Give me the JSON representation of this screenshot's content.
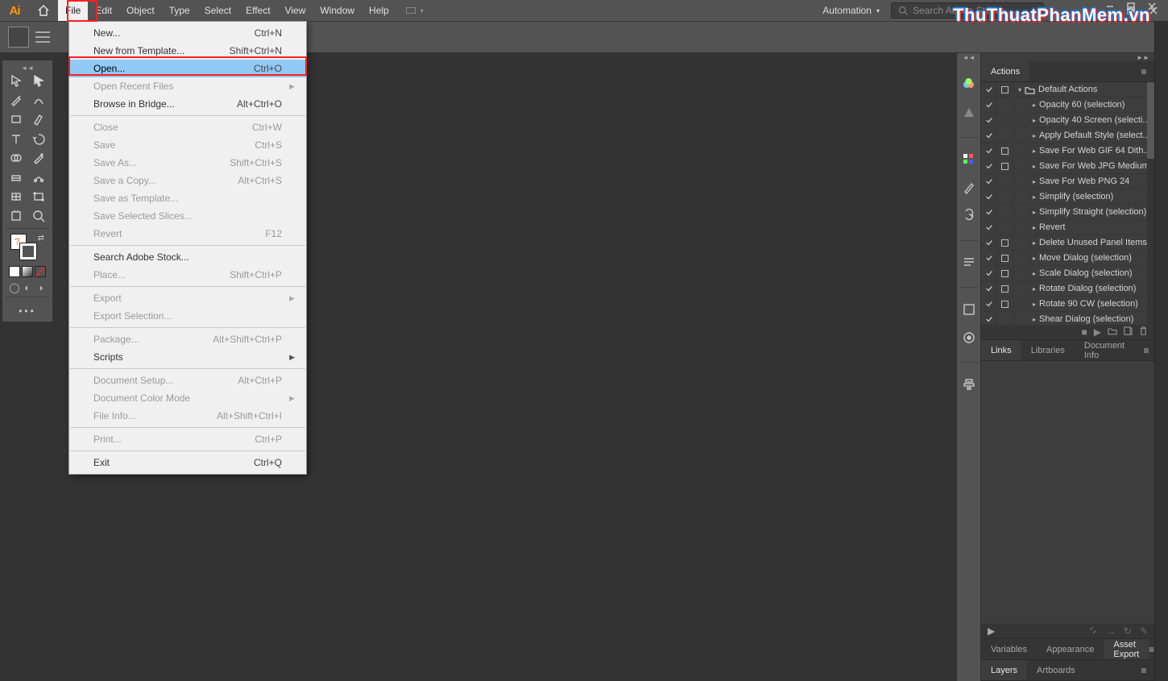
{
  "app_logo_text": "Ai",
  "menubar": {
    "items": [
      "File",
      "Edit",
      "Object",
      "Type",
      "Select",
      "Effect",
      "View",
      "Window",
      "Help"
    ],
    "workspace_label": "Automation",
    "search_placeholder": "Search Adobe Stock"
  },
  "file_menu": {
    "groups": [
      [
        {
          "label": "New...",
          "shortcut": "Ctrl+N",
          "disabled": false
        },
        {
          "label": "New from Template...",
          "shortcut": "Shift+Ctrl+N",
          "disabled": false
        },
        {
          "label": "Open...",
          "shortcut": "Ctrl+O",
          "disabled": false,
          "selected": true
        },
        {
          "label": "Open Recent Files",
          "shortcut": "",
          "disabled": true,
          "submenu": true
        },
        {
          "label": "Browse in Bridge...",
          "shortcut": "Alt+Ctrl+O",
          "disabled": false
        }
      ],
      [
        {
          "label": "Close",
          "shortcut": "Ctrl+W",
          "disabled": true
        },
        {
          "label": "Save",
          "shortcut": "Ctrl+S",
          "disabled": true
        },
        {
          "label": "Save As...",
          "shortcut": "Shift+Ctrl+S",
          "disabled": true
        },
        {
          "label": "Save a Copy...",
          "shortcut": "Alt+Ctrl+S",
          "disabled": true
        },
        {
          "label": "Save as Template...",
          "shortcut": "",
          "disabled": true
        },
        {
          "label": "Save Selected Slices...",
          "shortcut": "",
          "disabled": true
        },
        {
          "label": "Revert",
          "shortcut": "F12",
          "disabled": true
        }
      ],
      [
        {
          "label": "Search Adobe Stock...",
          "shortcut": "",
          "disabled": false
        },
        {
          "label": "Place...",
          "shortcut": "Shift+Ctrl+P",
          "disabled": true
        }
      ],
      [
        {
          "label": "Export",
          "shortcut": "",
          "disabled": true,
          "submenu": true
        },
        {
          "label": "Export Selection...",
          "shortcut": "",
          "disabled": true
        }
      ],
      [
        {
          "label": "Package...",
          "shortcut": "Alt+Shift+Ctrl+P",
          "disabled": true
        },
        {
          "label": "Scripts",
          "shortcut": "",
          "disabled": false,
          "submenu": true
        }
      ],
      [
        {
          "label": "Document Setup...",
          "shortcut": "Alt+Ctrl+P",
          "disabled": true
        },
        {
          "label": "Document Color Mode",
          "shortcut": "",
          "disabled": true,
          "submenu": true
        },
        {
          "label": "File Info...",
          "shortcut": "Alt+Shift+Ctrl+I",
          "disabled": true
        }
      ],
      [
        {
          "label": "Print...",
          "shortcut": "Ctrl+P",
          "disabled": true
        }
      ],
      [
        {
          "label": "Exit",
          "shortcut": "Ctrl+Q",
          "disabled": false
        }
      ]
    ]
  },
  "actions_panel": {
    "tab": "Actions",
    "folder": "Default Actions",
    "items": [
      {
        "check": true,
        "stop": false,
        "label": "Opacity 60 (selection)"
      },
      {
        "check": true,
        "stop": false,
        "label": "Opacity 40 Screen (selecti..."
      },
      {
        "check": true,
        "stop": false,
        "label": "Apply Default Style (select..."
      },
      {
        "check": true,
        "stop": true,
        "label": "Save For Web GIF 64 Dith..."
      },
      {
        "check": true,
        "stop": true,
        "label": "Save For Web JPG Medium"
      },
      {
        "check": true,
        "stop": false,
        "label": "Save For Web PNG 24"
      },
      {
        "check": true,
        "stop": false,
        "label": "Simplify (selection)"
      },
      {
        "check": true,
        "stop": false,
        "label": "Simplify Straight (selection)"
      },
      {
        "check": true,
        "stop": false,
        "label": "Revert"
      },
      {
        "check": true,
        "stop": true,
        "label": "Delete Unused Panel Items"
      },
      {
        "check": true,
        "stop": true,
        "label": "Move Dialog (selection)"
      },
      {
        "check": true,
        "stop": true,
        "label": "Scale Dialog (selection)"
      },
      {
        "check": true,
        "stop": true,
        "label": "Rotate Dialog (selection)"
      },
      {
        "check": true,
        "stop": true,
        "label": "Rotate 90 CW (selection)"
      },
      {
        "check": true,
        "stop": false,
        "label": "Shear Dialog (selection)"
      }
    ]
  },
  "links_panel": {
    "tabs": [
      "Links",
      "Libraries",
      "Document Info"
    ],
    "active": 0
  },
  "mid_panel": {
    "tabs": [
      "Variables",
      "Appearance",
      "Asset Export"
    ],
    "active": 2
  },
  "layers_panel": {
    "tabs": [
      "Layers",
      "Artboards"
    ],
    "active": 0
  },
  "watermark": "ThuThuatPhanMem.vn",
  "tool_tips": [
    "selection-tool",
    "direct-selection-tool",
    "pen-tool",
    "curvature-tool",
    "rectangle-tool",
    "paintbrush-tool",
    "type-tool",
    "rotate-tool",
    "shape-builder-tool",
    "eyedropper-tool",
    "gradient-tool",
    "width-tool",
    "mesh-tool",
    "free-transform-tool",
    "artboard-tool",
    "zoom-tool"
  ],
  "right_dock_icons": [
    "color-icon",
    "color-guide-icon",
    "sep",
    "swatches-icon",
    "brushes-icon",
    "symbols-icon",
    "sep",
    "paragraph-icon",
    "sep",
    "appearance-icon",
    "graphic-styles-icon",
    "sep",
    "align-icon"
  ]
}
